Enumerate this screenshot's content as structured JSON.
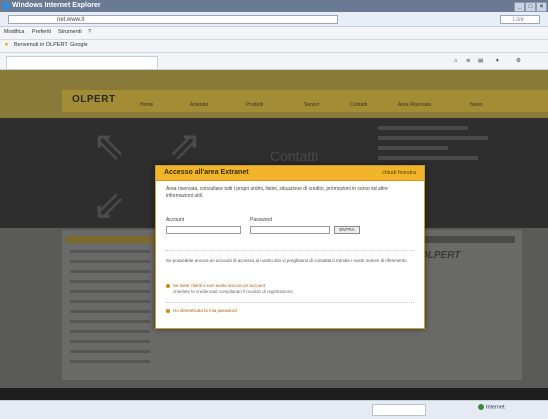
{
  "window": {
    "title": "Windows Internet Explorer",
    "controls": [
      "_",
      "□",
      "×"
    ]
  },
  "address": {
    "url": "net.www.it",
    "search_placeholder": "Live"
  },
  "menu": [
    "Modifica",
    "Preferiti",
    "Strumenti",
    "?"
  ],
  "favorites": [
    "Benvenuti in OLPERT",
    "Google"
  ],
  "page": {
    "logo": "OLPERT",
    "nav": [
      "Home",
      "Azienda",
      "Prodotti",
      "Servizi",
      "Contatti",
      "Area Riservata",
      "News"
    ],
    "hero_title": "Contatti",
    "right_logo": "OLPERT"
  },
  "modal": {
    "title": "Accesso all'area Extranet",
    "close_label": "chiudi finestra",
    "intro": "Area riservata, consultare tutti i propri ordini, listini, situazione di credito, promozioni in corso ed altre informazioni utili.",
    "user_label": "Account",
    "password_label": "Password",
    "login_button": "ENTRA",
    "note": "Se possedete ancora un account di accesso al nostro sito vi preghiamo di contattarci tramite i nostri numeri di riferimento.",
    "links": [
      {
        "label": "Se siete clienti e non avete ancora un account",
        "sub": "chiedete le credenziali compilando il modulo di registrazione"
      },
      {
        "label": "Ho dimenticato la mia password"
      }
    ]
  },
  "status": {
    "zone": "Internet"
  }
}
